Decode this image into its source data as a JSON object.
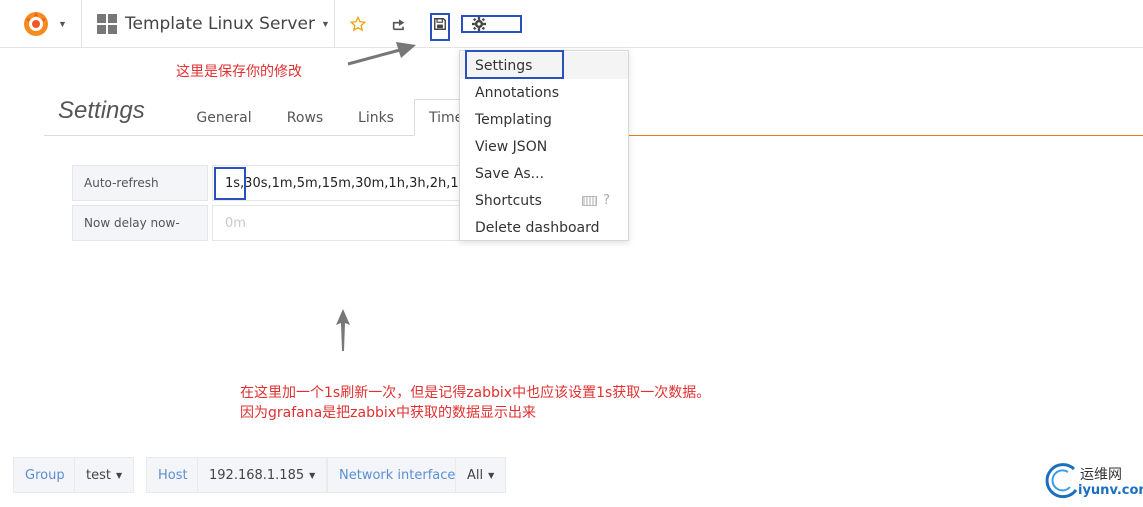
{
  "navbar": {
    "dashboard_title": "Template Linux Server",
    "icons": [
      "grafana-logo-icon",
      "dashboard-grid-icon",
      "star-icon",
      "share-icon",
      "save-icon",
      "gear-icon"
    ]
  },
  "annotations": {
    "save_note": "这里是保存你的修改",
    "refresh_note_line1": "在这里加一个1s刷新一次，但是记得zabbix中也应该设置1s获取一次数据。",
    "refresh_note_line2": "因为grafana是把zabbix中获取的数据显示出来"
  },
  "settings": {
    "title": "Settings",
    "tabs": [
      {
        "label": "General",
        "active": false
      },
      {
        "label": "Rows",
        "active": false
      },
      {
        "label": "Links",
        "active": false
      },
      {
        "label": "Time",
        "active": true
      }
    ],
    "fields": [
      {
        "label": "Auto-refresh",
        "value": "1s,30s,1m,5m,15m,30m,1h,3h,2h,1d",
        "placeholder": ""
      },
      {
        "label": "Now delay now-",
        "value": "",
        "placeholder": "0m"
      }
    ]
  },
  "menu": {
    "items": [
      {
        "label": "Settings",
        "highlighted": true
      },
      {
        "label": "Annotations"
      },
      {
        "label": "Templating"
      },
      {
        "label": "View JSON"
      },
      {
        "label": "Save As..."
      },
      {
        "label": "Shortcuts",
        "hint": "?"
      },
      {
        "label": "Delete dashboard"
      }
    ]
  },
  "variables": [
    {
      "label": "Group",
      "value": "test"
    },
    {
      "label": "Host",
      "value": "192.168.1.185"
    },
    {
      "label": "Network interface",
      "value": "All"
    }
  ],
  "watermark": {
    "cn": "运维网",
    "url": "iyunv.com"
  },
  "colors": {
    "accent_orange": "#eb7b18",
    "annotation_red": "#e03030",
    "highlight_blue": "#2b4fbd",
    "variable_blue": "#5b8ed1",
    "star_yellow": "#f2a40c"
  }
}
